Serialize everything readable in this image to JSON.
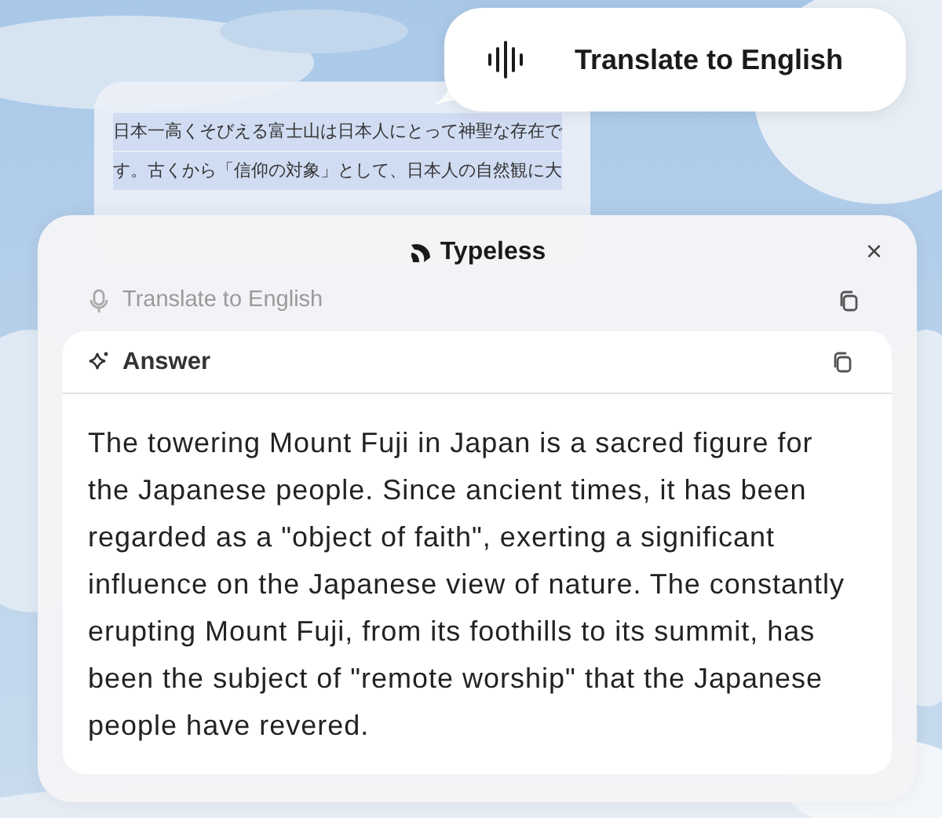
{
  "source_text": {
    "lines": [
      "日本一高くそびえる富士山は日本人にとって神聖な存在で",
      "す。古くから「信仰の対象」として、日本人の自然観に大"
    ],
    "highlighted": true
  },
  "command_bubble": {
    "label": "Translate to English"
  },
  "panel": {
    "title": "Typeless",
    "close": "×",
    "prompt": "Translate to English",
    "answer": {
      "heading": "Answer",
      "text": "The towering Mount Fuji in Japan is a sacred figure for the Japanese people. Since ancient times, it has been regarded as a \"object of faith\", exerting a significant influence on the Japanese view of nature. The constantly erupting Mount Fuji, from its foothills to its summit, has been the subject of \"remote worship\" that the Japanese people have revered."
    }
  }
}
